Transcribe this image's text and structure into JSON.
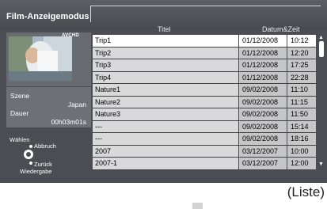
{
  "screen": {
    "title": "Film-Anzeigemodus",
    "hd_badge": "AVCHD"
  },
  "columns": {
    "title": "Titel",
    "datetime": "Datum&Zeit"
  },
  "info": {
    "scene_label": "Szene",
    "scene_value": "Japan",
    "duration_label": "Dauer",
    "duration_value": "00h03m01s"
  },
  "controls": {
    "select": "Wählen",
    "cancel": "Abbruch",
    "back": "Zurück",
    "play": "Wiedergabe"
  },
  "list": {
    "selected_index": 0,
    "rows": [
      {
        "title": "Trip1",
        "date": "01/12/2008",
        "time": "10:12"
      },
      {
        "title": "Trip2",
        "date": "01/12/2008",
        "time": "12:20"
      },
      {
        "title": "Trip3",
        "date": "01/12/2008",
        "time": "17:25"
      },
      {
        "title": "Trip4",
        "date": "01/12/2008",
        "time": "22:28"
      },
      {
        "title": "Nature1",
        "date": "09/02/2008",
        "time": "11:10"
      },
      {
        "title": "Nature2",
        "date": "09/02/2008",
        "time": "11:15"
      },
      {
        "title": "Nature3",
        "date": "09/02/2008",
        "time": "11:50"
      },
      {
        "title": "---",
        "date": "09/02/2008",
        "time": "15:14"
      },
      {
        "title": "---",
        "date": "09/02/2008",
        "time": "18:16"
      },
      {
        "title": "2007",
        "date": "03/12/2007",
        "time": "10:00"
      },
      {
        "title": "2007-1",
        "date": "03/12/2007",
        "time": "12:00"
      }
    ]
  },
  "caption": "(Liste)",
  "icons": {
    "scroll_up": "arrow-up-icon",
    "scroll_down": "arrow-down-icon",
    "dpad": "dpad-icon"
  }
}
